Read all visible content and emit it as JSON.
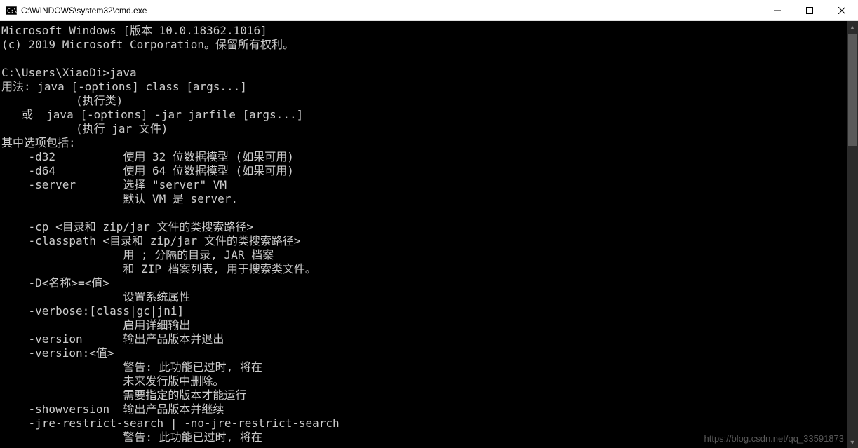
{
  "window": {
    "title": "C:\\WINDOWS\\system32\\cmd.exe"
  },
  "terminal": {
    "lines": [
      "Microsoft Windows [版本 10.0.18362.1016]",
      "(c) 2019 Microsoft Corporation。保留所有权利。",
      "",
      "C:\\Users\\XiaoDi>java",
      "用法: java [-options] class [args...]",
      "           (执行类)",
      "   或  java [-options] -jar jarfile [args...]",
      "           (执行 jar 文件)",
      "其中选项包括:",
      "    -d32          使用 32 位数据模型 (如果可用)",
      "    -d64          使用 64 位数据模型 (如果可用)",
      "    -server       选择 \"server\" VM",
      "                  默认 VM 是 server.",
      "",
      "    -cp <目录和 zip/jar 文件的类搜索路径>",
      "    -classpath <目录和 zip/jar 文件的类搜索路径>",
      "                  用 ; 分隔的目录, JAR 档案",
      "                  和 ZIP 档案列表, 用于搜索类文件。",
      "    -D<名称>=<值>",
      "                  设置系统属性",
      "    -verbose:[class|gc|jni]",
      "                  启用详细输出",
      "    -version      输出产品版本并退出",
      "    -version:<值>",
      "                  警告: 此功能已过时, 将在",
      "                  未来发行版中删除。",
      "                  需要指定的版本才能运行",
      "    -showversion  输出产品版本并继续",
      "    -jre-restrict-search | -no-jre-restrict-search",
      "                  警告: 此功能已过时, 将在"
    ]
  },
  "watermark": "https://blog.csdn.net/qq_33591873"
}
